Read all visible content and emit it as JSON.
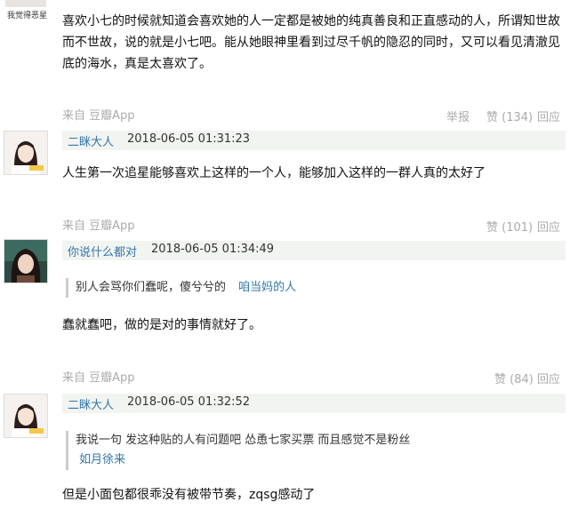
{
  "top_partial": {
    "caption": "我觉得恶星",
    "text": "喜欢小七的时候就知道会喜欢她的人一定都是被她的纯真善良和正直感动的人，所谓知世故而不世故，说的就是小七吧。能从她眼神里看到过尽千帆的隐忍的同时，又可以看见清澈见底的海水，真是太喜欢了。",
    "source": "来自 豆瓣App",
    "report": "举报",
    "like": "赞 (134)",
    "reply": "回应"
  },
  "comments": [
    {
      "username": "二眯大人",
      "time": "2018-06-05 01:31:23",
      "text": "人生第一次追星能够喜欢上这样的一个人，能够加入这样的一群人真的太好了",
      "source": "来自 豆瓣App",
      "like": "赞 (101)",
      "reply": "回应"
    },
    {
      "username": "你说什么都对",
      "time": "2018-06-05 01:34:49",
      "quote_text": "别人会骂你们蠢呢，傻兮兮的",
      "quote_author": "咱当妈的人",
      "text": "蠢就蠢吧，做的是对的事情就好了。",
      "source": "来自 豆瓣App",
      "like": "赞 (84)",
      "reply": "回应"
    },
    {
      "username": "二眯大人",
      "time": "2018-06-05 01:32:52",
      "quote_text": "我说一句 发这种贴的人有问题吧 怂恿七家买票 而且感觉不是粉丝",
      "quote_author": "如月徐来",
      "text": "但是小面包都很乖没有被带节奏，zqsg感动了"
    }
  ]
}
